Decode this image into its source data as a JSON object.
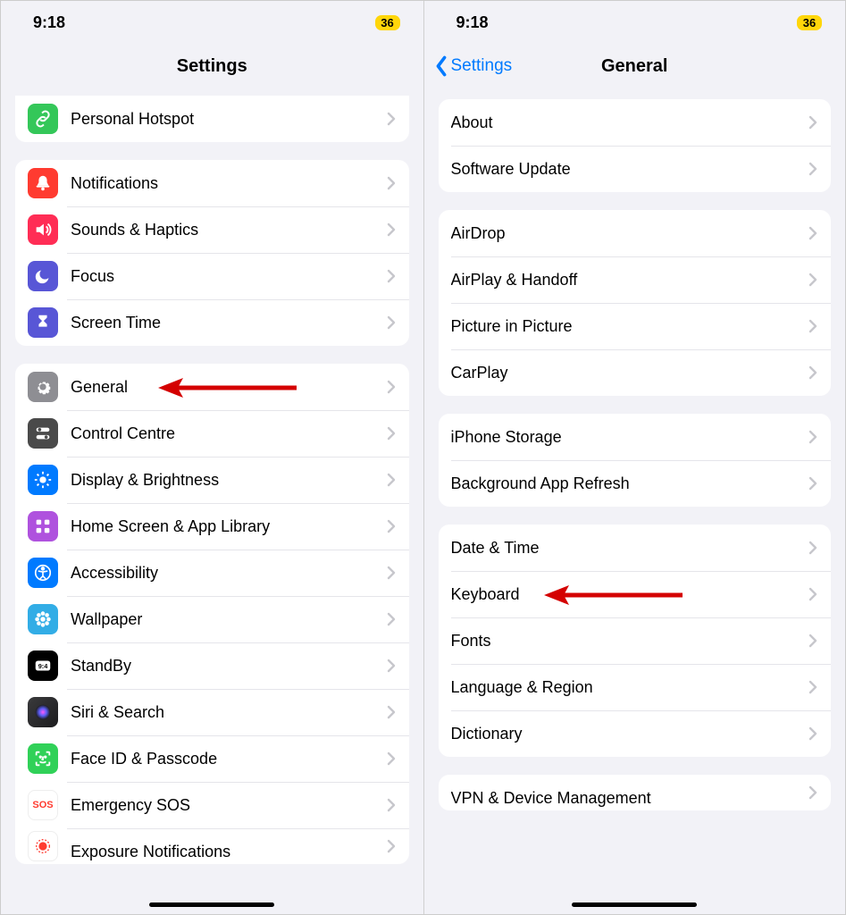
{
  "status": {
    "time": "9:18",
    "battery": "36"
  },
  "left": {
    "title": "Settings",
    "groups": [
      {
        "rows": [
          {
            "id": "personal-hotspot",
            "label": "Personal Hotspot",
            "icon": "link-icon",
            "color": "c-green"
          }
        ]
      },
      {
        "rows": [
          {
            "id": "notifications",
            "label": "Notifications",
            "icon": "bell-icon",
            "color": "c-red"
          },
          {
            "id": "sounds-haptics",
            "label": "Sounds & Haptics",
            "icon": "speaker-icon",
            "color": "c-pink"
          },
          {
            "id": "focus",
            "label": "Focus",
            "icon": "moon-icon",
            "color": "c-indigo"
          },
          {
            "id": "screen-time",
            "label": "Screen Time",
            "icon": "hourglass-icon",
            "color": "c-indigo"
          }
        ]
      },
      {
        "rows": [
          {
            "id": "general",
            "label": "General",
            "icon": "gear-icon",
            "color": "c-gray",
            "arrow": true
          },
          {
            "id": "control-centre",
            "label": "Control Centre",
            "icon": "toggles-icon",
            "color": "c-darkgray"
          },
          {
            "id": "display-brightness",
            "label": "Display & Brightness",
            "icon": "sun-icon",
            "color": "c-blue"
          },
          {
            "id": "home-screen-app-library",
            "label": "Home Screen & App Library",
            "icon": "grid-icon",
            "color": "c-purple"
          },
          {
            "id": "accessibility",
            "label": "Accessibility",
            "icon": "accessibility-icon",
            "color": "c-blue"
          },
          {
            "id": "wallpaper",
            "label": "Wallpaper",
            "icon": "flower-icon",
            "color": "c-teal"
          },
          {
            "id": "standby",
            "label": "StandBy",
            "icon": "clock-icon",
            "color": "c-black"
          },
          {
            "id": "siri-search",
            "label": "Siri & Search",
            "icon": "siri-icon",
            "color": "c-siri"
          },
          {
            "id": "face-id-passcode",
            "label": "Face ID & Passcode",
            "icon": "faceid-icon",
            "color": "c-facegreen"
          },
          {
            "id": "emergency-sos",
            "label": "Emergency SOS",
            "icon": "sos-icon",
            "color": "c-sos"
          },
          {
            "id": "exposure-notifications",
            "label": "Exposure Notifications",
            "icon": "exposure-icon",
            "color": "c-white",
            "cutoff": true
          }
        ]
      }
    ]
  },
  "right": {
    "title": "General",
    "back": "Settings",
    "groups": [
      {
        "rows": [
          {
            "id": "about",
            "label": "About"
          },
          {
            "id": "software-update",
            "label": "Software Update"
          }
        ]
      },
      {
        "rows": [
          {
            "id": "airdrop",
            "label": "AirDrop"
          },
          {
            "id": "airplay-handoff",
            "label": "AirPlay & Handoff"
          },
          {
            "id": "picture-in-picture",
            "label": "Picture in Picture"
          },
          {
            "id": "carplay",
            "label": "CarPlay"
          }
        ]
      },
      {
        "rows": [
          {
            "id": "iphone-storage",
            "label": "iPhone Storage"
          },
          {
            "id": "background-app-refresh",
            "label": "Background App Refresh"
          }
        ]
      },
      {
        "rows": [
          {
            "id": "date-time",
            "label": "Date & Time"
          },
          {
            "id": "keyboard",
            "label": "Keyboard",
            "arrow": true
          },
          {
            "id": "fonts",
            "label": "Fonts"
          },
          {
            "id": "language-region",
            "label": "Language & Region"
          },
          {
            "id": "dictionary",
            "label": "Dictionary"
          }
        ]
      },
      {
        "rows": [
          {
            "id": "vpn-device-management",
            "label": "VPN & Device Management",
            "cutoff": true
          }
        ]
      }
    ]
  }
}
